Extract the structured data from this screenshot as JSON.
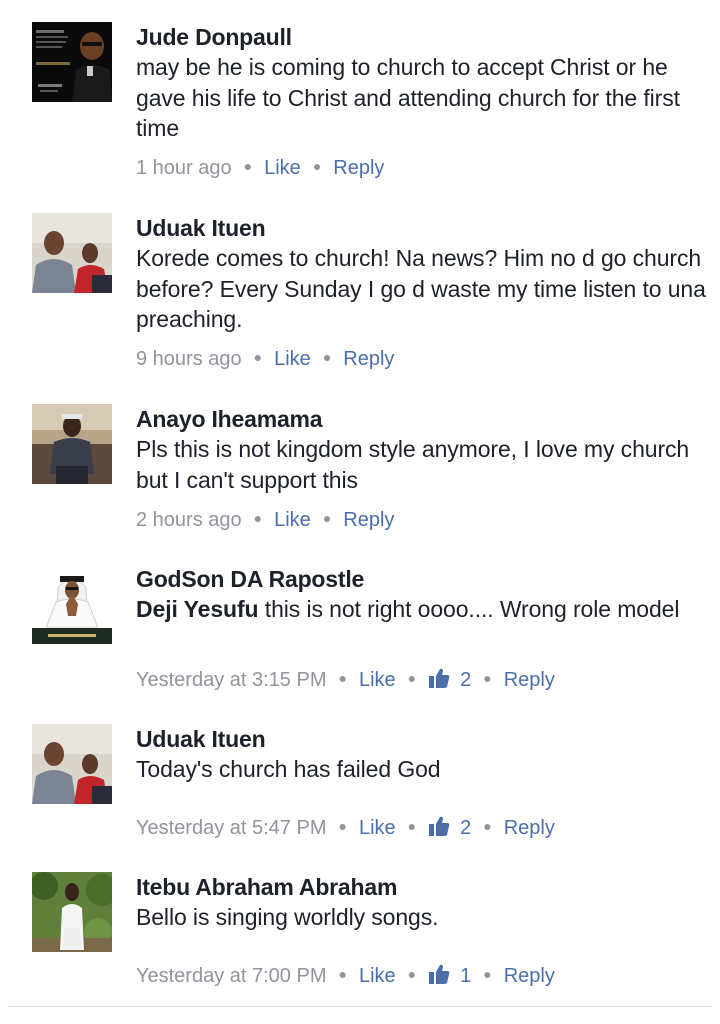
{
  "comments": [
    {
      "author": "Jude Donpaull",
      "text": "may be he is coming to church to accept Christ or he gave his life to Christ and attending church for the first time",
      "mention": "",
      "time": "1 hour ago",
      "like_label": "Like",
      "reply_label": "Reply",
      "reactions": null,
      "avatar_icon": "profile-photo-poster"
    },
    {
      "author": "Uduak Ituen",
      "text": "Korede comes to church!  Na news?  Him no d go church before?  Every Sunday I go d waste my time listen to una preaching.",
      "mention": "",
      "time": "9 hours ago",
      "like_label": "Like",
      "reply_label": "Reply",
      "reactions": null,
      "avatar_icon": "profile-photo-two-men"
    },
    {
      "author": "Anayo Iheamama",
      "text": "Pls this is not kingdom style anymore, I love my church but I can't support this",
      "mention": "",
      "time": "2 hours ago",
      "like_label": "Like",
      "reply_label": "Reply",
      "reactions": null,
      "avatar_icon": "profile-photo-seated-man"
    },
    {
      "author": "GodSon DA Rapostle",
      "text": " this is not right oooo.... Wrong role model",
      "mention": "Deji Yesufu",
      "time": "Yesterday at 3:15 PM",
      "like_label": "Like",
      "reply_label": "Reply",
      "reactions": "2",
      "avatar_icon": "profile-photo-prince-of-arabia"
    },
    {
      "author": "Uduak Ituen",
      "text": "Today's church has failed God",
      "mention": "",
      "time": "Yesterday at 5:47 PM",
      "like_label": "Like",
      "reply_label": "Reply",
      "reactions": "2",
      "avatar_icon": "profile-photo-two-men"
    },
    {
      "author": "Itebu Abraham Abraham",
      "text": "Bello is singing worldly songs.",
      "mention": "",
      "time": "Yesterday at 7:00 PM",
      "like_label": "Like",
      "reply_label": "Reply",
      "reactions": "1",
      "avatar_icon": "profile-photo-man-garden"
    }
  ],
  "colors": {
    "author": "#1d2129",
    "meta": "#90949c",
    "action": "#4b6eaa"
  }
}
